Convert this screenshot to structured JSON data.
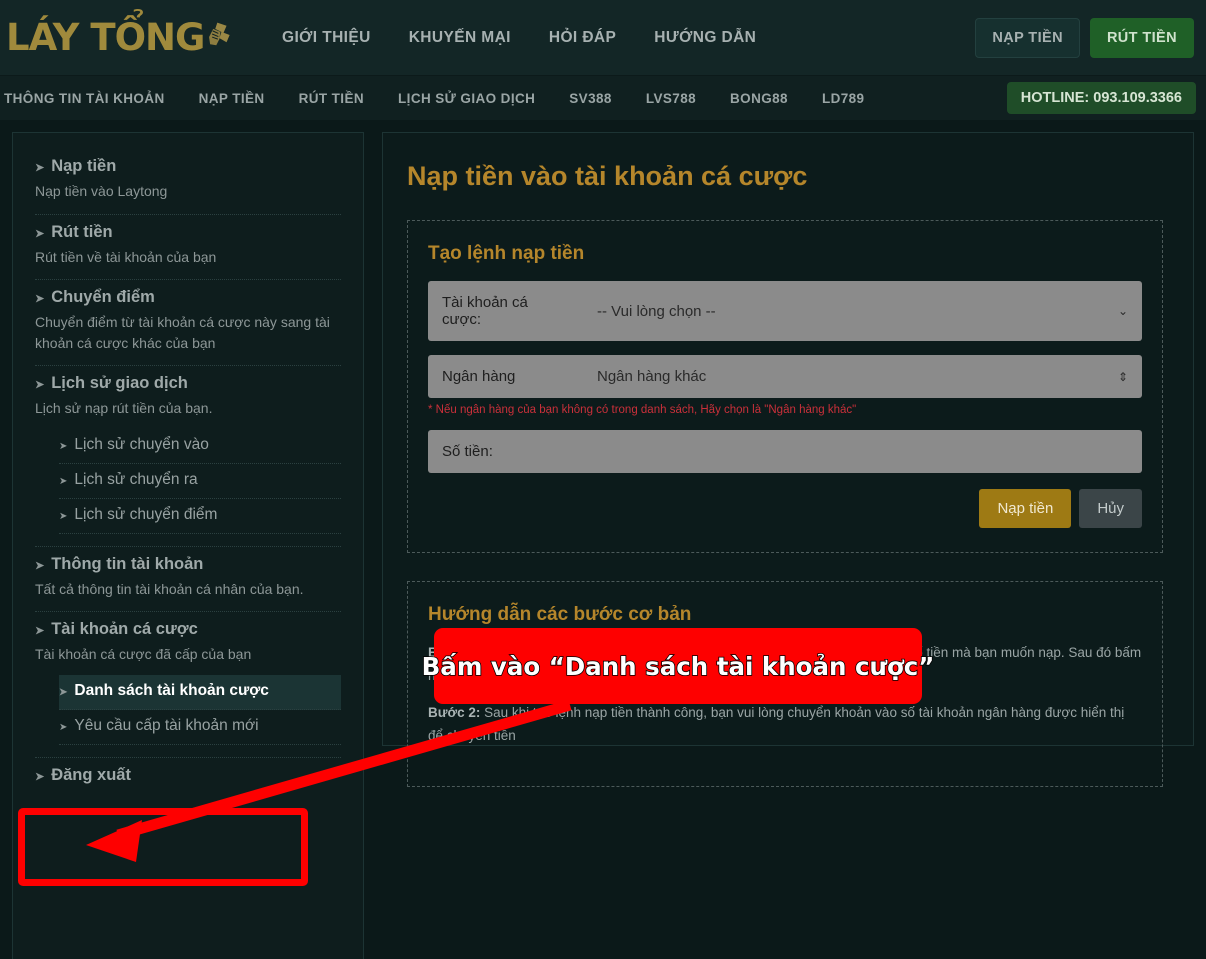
{
  "header": {
    "logo_text": "LÁY TỔNG",
    "nav": [
      {
        "label": "GIỚI THIỆU"
      },
      {
        "label": "KHUYẾN MẠI"
      },
      {
        "label": "HỎI ĐÁP"
      },
      {
        "label": "HƯỚNG DẪN"
      }
    ],
    "deposit_button": "NẠP TIỀN",
    "withdraw_button": "RÚT TIỀN"
  },
  "subnav": {
    "items": [
      {
        "label": "THÔNG TIN TÀI KHOẢN"
      },
      {
        "label": "NẠP TIỀN"
      },
      {
        "label": "RÚT TIỀN"
      },
      {
        "label": "LỊCH SỬ GIAO DỊCH"
      },
      {
        "label": "SV388"
      },
      {
        "label": "LVS788"
      },
      {
        "label": "BONG88"
      },
      {
        "label": "LD789"
      }
    ],
    "hotline": "HOTLINE: 093.109.3366"
  },
  "sidebar": {
    "blocks": [
      {
        "title": "Nạp tiền",
        "desc": "Nạp tiền vào Laytong",
        "sub": []
      },
      {
        "title": "Rút tiền",
        "desc": "Rút tiền về tài khoản của bạn",
        "sub": []
      },
      {
        "title": "Chuyển điểm",
        "desc": "Chuyển điểm từ tài khoản cá cược này sang tài khoản cá cược khác của bạn",
        "sub": []
      },
      {
        "title": "Lịch sử giao dịch",
        "desc": "Lịch sử nạp rút tiền của bạn.",
        "sub": [
          {
            "label": "Lịch sử chuyển vào"
          },
          {
            "label": "Lịch sử chuyển ra"
          },
          {
            "label": "Lịch sử chuyển điểm"
          }
        ]
      },
      {
        "title": "Thông tin tài khoản",
        "desc": "Tất cả thông tin tài khoản cá nhân của bạn.",
        "sub": []
      },
      {
        "title": "Tài khoản cá cược",
        "desc": "Tài khoản cá cược đã cấp của bạn",
        "sub": [
          {
            "label": "Danh sách tài khoản cược"
          },
          {
            "label": "Yêu cầu cấp tài khoản mới"
          }
        ]
      },
      {
        "title": "Đăng xuất",
        "desc": "",
        "sub": []
      }
    ],
    "arrow_glyph": "➤"
  },
  "main": {
    "page_title": "Nạp tiền vào tài khoản cá cược",
    "form": {
      "card_title": "Tạo lệnh nạp tiền",
      "account_label": "Tài khoản cá cược:",
      "account_value": "-- Vui lòng chọn --",
      "bank_label": "Ngân hàng",
      "bank_value": "Ngân hàng khác",
      "bank_note": "* Nếu ngân hàng của bạn không có trong danh sách, Hãy chọn là \"Ngân hàng khác\"",
      "amount_label": "Số tiền:",
      "amount_value": "",
      "amount_placeholder": "",
      "submit_label": "Nạp tiền",
      "cancel_label": "Hủy",
      "select_caret": "⌄",
      "stepper_caret": "⇕"
    },
    "guide": {
      "card_title": "Hướng dẫn các bước cơ bản",
      "step1_prefix": "Bước 1:",
      "step1_text": " Tại mục \"Tạo lệnh nạp tiền\" vui lòng chọn ngân hàng mà bạn có, nhập số tiền mà bạn muốn nạp. Sau đó bấm nạp tiền (Lưu ý: số tiền nạp phải lớn hơn 300.000 vnđ)",
      "step2_prefix": "Bước 2:",
      "step2_text": " Sau khi tạo lệnh nạp tiền thành công, bạn vui lòng chuyển khoản vào số tài khoản ngân hàng được hiển thị để chuyển tiền"
    }
  },
  "annotations": {
    "callout_text": "Bấm vào “Danh sách tài khoản cược”",
    "arrow_color": "#fe0000",
    "box_color": "#fe0000"
  },
  "colors": {
    "gold": "#b5862b",
    "green": "#1f6027",
    "page_bg": "#0b1919",
    "panel_bg": "#0e1d1d",
    "red": "#fe0000"
  }
}
